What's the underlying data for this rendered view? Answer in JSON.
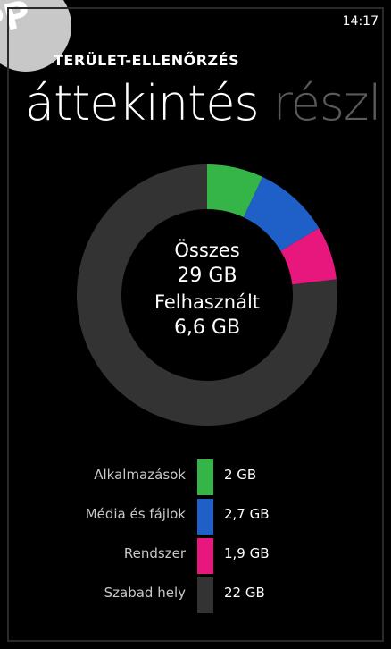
{
  "status_bar": {
    "time": "14:17"
  },
  "badge": {
    "text": "PP"
  },
  "app": {
    "title": "TERÜLET-ELLENŐRZÉS"
  },
  "pivot": {
    "items": [
      {
        "label": "áttekintés",
        "active": true
      },
      {
        "label": "részl",
        "active": false
      }
    ]
  },
  "summary": {
    "total_label": "Összes",
    "total_value": "29 GB",
    "used_label": "Felhasznált",
    "used_value": "6,6 GB"
  },
  "colors": {
    "apps": "#35b548",
    "media": "#1f5fc8",
    "system": "#e8177e",
    "free": "#333333"
  },
  "legend": [
    {
      "label": "Alkalmazások",
      "value": "2 GB",
      "color": "#35b548"
    },
    {
      "label": "Média és fájlok",
      "value": "2,7 GB",
      "color": "#1f5fc8"
    },
    {
      "label": "Rendszer",
      "value": "1,9 GB",
      "color": "#e8177e"
    },
    {
      "label": "Szabad hely",
      "value": "22 GB",
      "color": "#333333"
    }
  ],
  "chart_data": {
    "type": "pie",
    "categories": [
      "Alkalmazások",
      "Média és fájlok",
      "Rendszer",
      "Szabad hely"
    ],
    "values": [
      2,
      2.7,
      1.9,
      22
    ],
    "unit": "GB"
  }
}
